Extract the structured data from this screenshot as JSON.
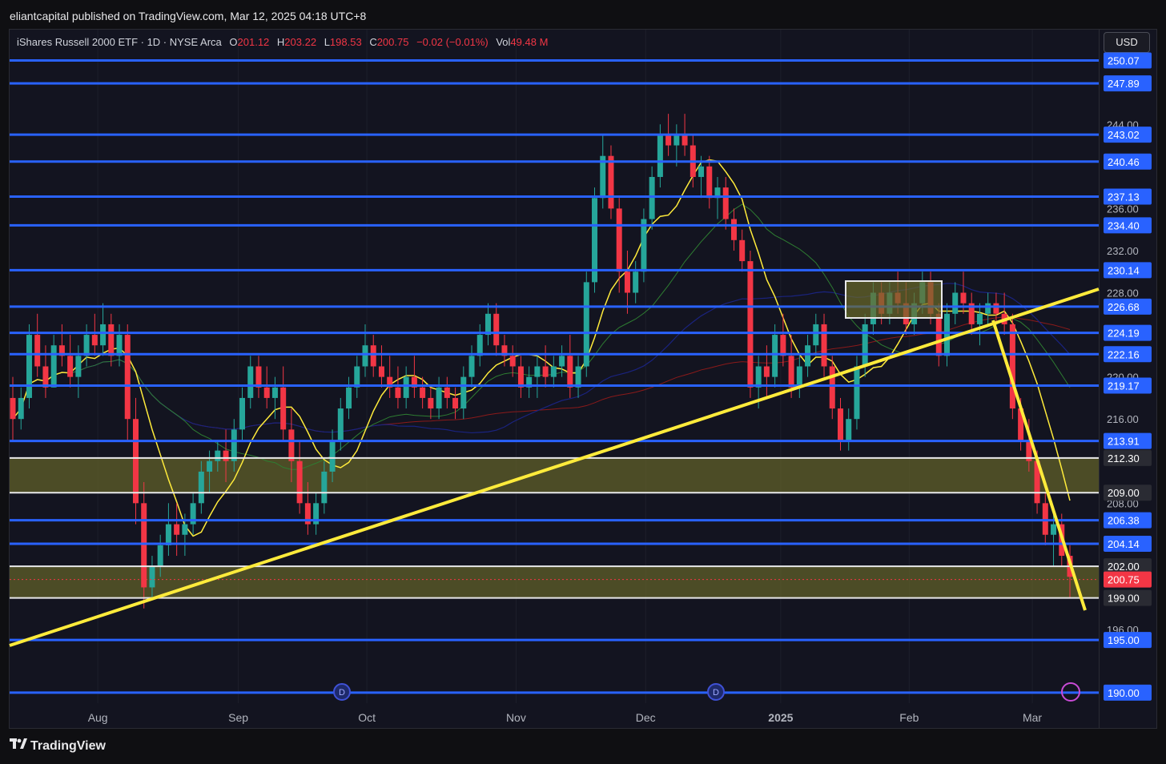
{
  "publisher": "eliantcapital published on TradingView.com, Mar 12, 2025 04:18 UTC+8",
  "currency": "USD",
  "legend": {
    "name": "iShares Russell 2000 ETF · 1D · NYSE Arca",
    "o_label": "O",
    "o": "201.12",
    "h_label": "H",
    "h": "203.22",
    "l_label": "L",
    "l": "198.53",
    "c_label": "C",
    "c": "200.75",
    "change": "−0.02 (−0.01%)",
    "vol_label": "Vol",
    "vol": "49.48 M"
  },
  "brand": "TradingView",
  "colors": {
    "up": "#26a69a",
    "down": "#f23645",
    "level_line": "#2962ff",
    "trend": "#ffeb3b",
    "zone": "#6b6a2a",
    "ma_fast": "#ffeb3b",
    "ma_mid": "#2e7d32",
    "ma_slow": "#1a237e",
    "ma_200": "#8b1a1a"
  },
  "chart_data": {
    "type": "candlestick",
    "symbol": "iShares Russell 2000 ETF",
    "interval": "1D",
    "exchange": "NYSE Arca",
    "ylim": [
      189,
      253
    ],
    "x_ticks": [
      {
        "label": "Aug",
        "pos": 0.081
      },
      {
        "label": "Sep",
        "pos": 0.21
      },
      {
        "label": "Oct",
        "pos": 0.328
      },
      {
        "label": "Nov",
        "pos": 0.465
      },
      {
        "label": "Dec",
        "pos": 0.584
      },
      {
        "label": "2025",
        "pos": 0.708,
        "bold": true
      },
      {
        "label": "Feb",
        "pos": 0.826
      },
      {
        "label": "Mar",
        "pos": 0.939
      }
    ],
    "y_ticks": [
      244.0,
      236.0,
      232.0,
      228.0,
      220.0,
      216.0,
      208.0,
      196.0
    ],
    "levels": [
      250.07,
      247.89,
      243.02,
      240.46,
      237.13,
      234.4,
      230.14,
      226.68,
      224.19,
      222.16,
      219.17,
      213.91,
      206.38,
      204.14,
      195.0,
      190.0
    ],
    "white_levels": [
      212.3,
      209.0,
      202.0,
      199.0
    ],
    "last_price": 200.75,
    "zones": [
      [
        209.0,
        212.3
      ],
      [
        199.0,
        202.0
      ]
    ],
    "candles": [
      [
        218,
        220,
        214,
        216
      ],
      [
        216,
        219,
        215,
        218
      ],
      [
        218,
        225,
        217,
        224
      ],
      [
        224,
        226,
        220,
        221
      ],
      [
        221,
        223,
        218,
        219
      ],
      [
        219,
        224,
        219,
        223
      ],
      [
        223,
        225,
        221,
        222
      ],
      [
        222,
        224,
        219,
        220
      ],
      [
        220,
        223,
        218,
        222
      ],
      [
        222,
        225,
        221,
        224
      ],
      [
        224,
        226,
        222,
        223
      ],
      [
        223,
        227,
        222,
        225
      ],
      [
        225,
        226,
        221,
        222
      ],
      [
        222,
        225,
        221,
        224
      ],
      [
        224,
        225,
        214,
        216
      ],
      [
        216,
        218,
        206,
        208
      ],
      [
        208,
        210,
        198,
        200
      ],
      [
        200,
        203,
        199,
        202
      ],
      [
        202,
        205,
        201,
        204
      ],
      [
        204,
        208,
        203,
        206
      ],
      [
        206,
        208,
        203,
        205
      ],
      [
        205,
        207,
        203,
        206
      ],
      [
        206,
        209,
        205,
        208
      ],
      [
        208,
        212,
        207,
        211
      ],
      [
        211,
        213,
        209,
        212
      ],
      [
        212,
        214,
        211,
        213
      ],
      [
        213,
        215,
        210,
        212
      ],
      [
        212,
        216,
        211,
        215
      ],
      [
        215,
        219,
        214,
        218
      ],
      [
        218,
        222,
        217,
        221
      ],
      [
        221,
        222,
        218,
        219
      ],
      [
        219,
        221,
        217,
        218
      ],
      [
        218,
        220,
        216,
        219
      ],
      [
        219,
        221,
        214,
        215
      ],
      [
        215,
        217,
        210,
        212
      ],
      [
        212,
        214,
        207,
        208
      ],
      [
        208,
        210,
        205,
        206
      ],
      [
        206,
        209,
        205,
        208
      ],
      [
        208,
        212,
        207,
        211
      ],
      [
        211,
        215,
        210,
        214
      ],
      [
        214,
        218,
        213,
        217
      ],
      [
        217,
        220,
        216,
        219
      ],
      [
        219,
        222,
        218,
        221
      ],
      [
        221,
        225,
        220,
        223
      ],
      [
        223,
        224,
        220,
        221
      ],
      [
        221,
        223,
        219,
        220
      ],
      [
        220,
        222,
        218,
        219
      ],
      [
        219,
        221,
        217,
        218
      ],
      [
        218,
        221,
        217,
        220
      ],
      [
        220,
        222,
        218,
        219
      ],
      [
        219,
        220,
        217,
        218
      ],
      [
        218,
        219,
        216,
        217
      ],
      [
        217,
        220,
        216,
        219
      ],
      [
        219,
        220,
        217,
        218
      ],
      [
        218,
        219,
        216,
        217
      ],
      [
        217,
        221,
        216,
        220
      ],
      [
        220,
        223,
        219,
        222
      ],
      [
        222,
        225,
        221,
        224
      ],
      [
        224,
        227,
        223,
        226
      ],
      [
        226,
        227,
        222,
        223
      ],
      [
        223,
        224,
        221,
        222
      ],
      [
        222,
        223,
        220,
        221
      ],
      [
        221,
        222,
        218,
        219
      ],
      [
        219,
        221,
        218,
        220
      ],
      [
        220,
        222,
        218,
        221
      ],
      [
        221,
        223,
        219,
        220
      ],
      [
        220,
        222,
        219,
        221
      ],
      [
        221,
        223,
        220,
        222
      ],
      [
        222,
        224,
        218,
        219
      ],
      [
        219,
        222,
        218,
        221
      ],
      [
        221,
        230,
        220,
        229
      ],
      [
        229,
        238,
        228,
        237
      ],
      [
        237,
        243,
        236,
        241
      ],
      [
        241,
        242,
        235,
        236
      ],
      [
        236,
        237,
        228,
        230
      ],
      [
        230,
        232,
        226,
        228
      ],
      [
        228,
        231,
        227,
        230
      ],
      [
        230,
        236,
        229,
        235
      ],
      [
        235,
        240,
        234,
        239
      ],
      [
        239,
        244,
        238,
        243
      ],
      [
        243,
        245,
        241,
        242
      ],
      [
        242,
        244,
        240,
        243
      ],
      [
        243,
        245,
        241,
        242
      ],
      [
        242,
        243,
        238,
        239
      ],
      [
        239,
        241,
        237,
        240
      ],
      [
        240,
        241,
        236,
        237
      ],
      [
        237,
        239,
        235,
        238
      ],
      [
        238,
        239,
        234,
        235
      ],
      [
        235,
        236,
        232,
        233
      ],
      [
        233,
        234,
        230,
        231
      ],
      [
        231,
        232,
        218,
        219
      ],
      [
        219,
        222,
        217,
        221
      ],
      [
        221,
        223,
        218,
        220
      ],
      [
        220,
        225,
        219,
        224
      ],
      [
        224,
        226,
        221,
        222
      ],
      [
        222,
        224,
        218,
        219
      ],
      [
        219,
        222,
        218,
        221
      ],
      [
        221,
        224,
        220,
        223
      ],
      [
        223,
        226,
        222,
        225
      ],
      [
        225,
        226,
        220,
        221
      ],
      [
        221,
        222,
        216,
        217
      ],
      [
        217,
        218,
        213,
        214
      ],
      [
        214,
        217,
        213,
        216
      ],
      [
        216,
        222,
        215,
        221
      ],
      [
        221,
        226,
        220,
        225
      ],
      [
        225,
        229,
        224,
        228
      ],
      [
        228,
        229,
        225,
        226
      ],
      [
        226,
        229,
        225,
        228
      ],
      [
        228,
        230,
        226,
        227
      ],
      [
        227,
        229,
        224,
        225
      ],
      [
        225,
        228,
        224,
        227
      ],
      [
        227,
        230,
        226,
        229
      ],
      [
        229,
        230,
        225,
        226
      ],
      [
        226,
        227,
        221,
        222
      ],
      [
        222,
        227,
        221,
        226
      ],
      [
        226,
        229,
        225,
        228
      ],
      [
        228,
        230,
        226,
        227
      ],
      [
        227,
        228,
        224,
        225
      ],
      [
        225,
        227,
        223,
        226
      ],
      [
        226,
        228,
        225,
        227
      ],
      [
        227,
        228,
        225,
        226
      ],
      [
        226,
        228,
        224,
        225
      ],
      [
        225,
        226,
        216,
        217
      ],
      [
        217,
        218,
        213,
        214
      ],
      [
        214,
        216,
        211,
        212
      ],
      [
        212,
        213,
        207,
        208
      ],
      [
        208,
        209,
        204,
        205
      ],
      [
        205,
        207,
        202,
        206
      ],
      [
        206,
        207,
        202,
        203
      ],
      [
        203,
        204,
        199,
        201
      ]
    ]
  }
}
